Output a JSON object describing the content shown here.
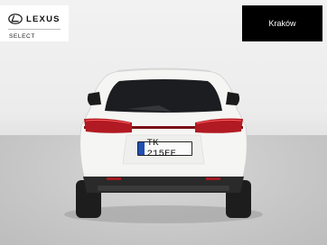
{
  "brand": {
    "name": "LEXUS",
    "program": "SELECT"
  },
  "location": {
    "label": "Kraków"
  },
  "vehicle": {
    "plate": "TK 215EE",
    "badge": "LEXUS"
  },
  "colors": {
    "logo_bg": "#ffffff",
    "location_bg": "#000000",
    "car_body": "#f4f4f2"
  }
}
